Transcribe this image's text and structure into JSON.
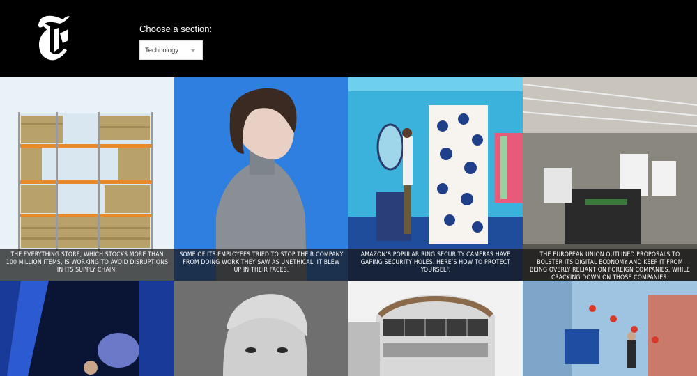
{
  "header": {
    "section_label": "Choose a section:",
    "selected_section": "Technology",
    "logo_icon": "nyt-logo-icon"
  },
  "articles": [
    {
      "abstract": "The Everything Store, which stocks more than 100 million items, is working to avoid disruptions in its supply chain."
    },
    {
      "abstract": "Some of its employees tried to stop their company from doing work they saw as unethical. It blew up in their faces."
    },
    {
      "abstract": "Amazon’s popular Ring security cameras have gaping security holes. Here’s how to protect yourself."
    },
    {
      "abstract": "The European Union outlined proposals to bolster its digital economy and keep it from being overly reliant on foreign companies, while cracking down on those companies."
    }
  ],
  "colors": {
    "background": "#000000",
    "caption_overlay": "#141414"
  }
}
